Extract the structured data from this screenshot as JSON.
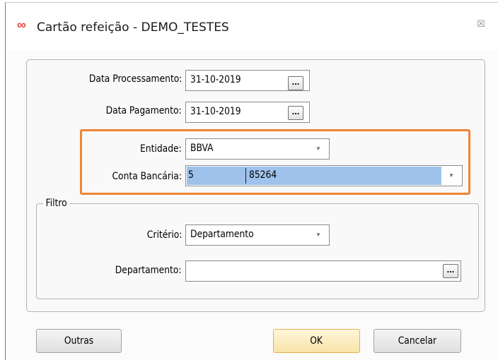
{
  "window": {
    "title": "Cartão refeição - DEMO_TESTES",
    "app_icon": "infinity-icon",
    "close_icon": "close-icon",
    "colors": {
      "highlight": "#f08432",
      "selection": "#9fc2ec",
      "ok_button": "#f8e3a8"
    }
  },
  "form": {
    "data_processamento": {
      "label": "Data Processamento:",
      "value": "31-10-2019",
      "button": "..."
    },
    "data_pagamento": {
      "label": "Data Pagamento:",
      "value": "31-10-2019",
      "button": "..."
    },
    "entidade": {
      "label": "Entidade:",
      "value": "BBVA"
    },
    "conta_bancaria": {
      "label": "Conta Bancária:",
      "value_code": "5",
      "value_account": "85264"
    }
  },
  "filtro": {
    "legend": "Filtro",
    "criterio": {
      "label": "Critério:",
      "value": "Departamento"
    },
    "departamento": {
      "label": "Departamento:",
      "value": "",
      "button": "..."
    }
  },
  "buttons": {
    "outras": "Outras",
    "ok": "OK",
    "cancelar": "Cancelar"
  }
}
